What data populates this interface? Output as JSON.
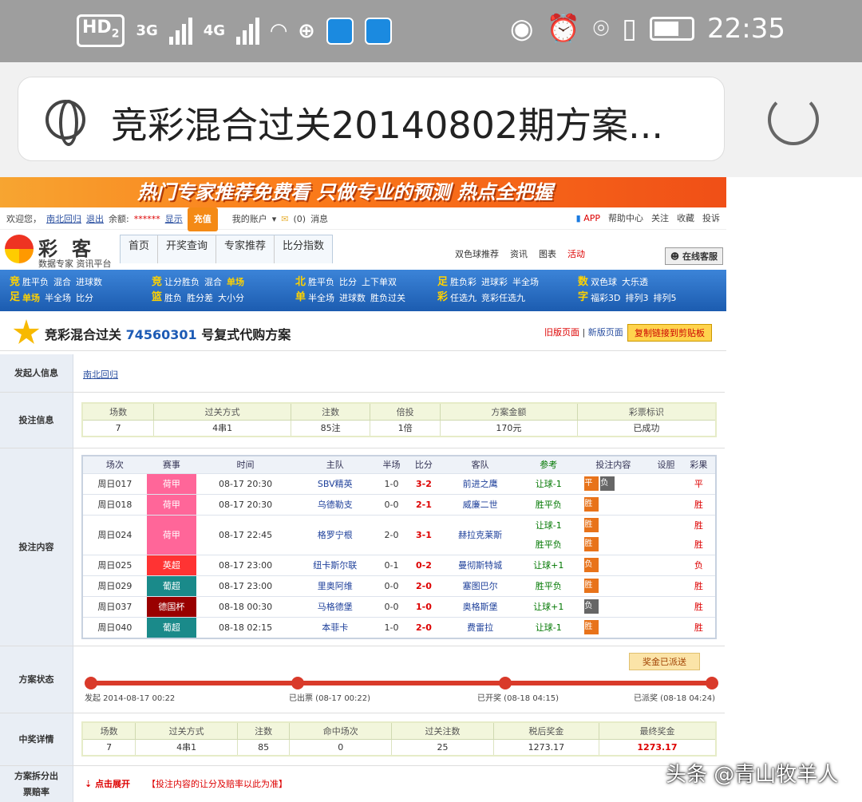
{
  "status_bar": {
    "hd": "HD",
    "sim2": "2",
    "net3g": "3G",
    "net4g": "4G",
    "time": "22:35"
  },
  "browser": {
    "url_title": "竞彩混合过关20140802期方案..."
  },
  "banner": {
    "text": "热门专家推荐免费看 只做专业的预测 热点全把握"
  },
  "topbar": {
    "welcome": "欢迎您，",
    "username": "南北回归",
    "logout": "退出",
    "balance_label": "余额:",
    "balance_value": "******",
    "show": "显示",
    "recharge": "充值",
    "my_account": "我的账户",
    "msgs": "(0)",
    "msg_label": "消息",
    "right": [
      "APP",
      "帮助中心",
      "关注",
      "收藏",
      "投诉"
    ]
  },
  "logo": {
    "title": "彩客",
    "sub": "数据专家 资讯平台"
  },
  "nav": {
    "items": [
      "首页",
      "开奖查询",
      "专家推荐",
      "比分指数"
    ],
    "right": [
      "双色球推荐",
      "资讯",
      "图表",
      "活动"
    ],
    "kefu": "在线客服"
  },
  "blue_nav": [
    {
      "tag": "竞足",
      "row1": [
        "胜平负",
        "混合",
        "进球数"
      ],
      "row2": [
        "单场",
        "半全场",
        "比分"
      ]
    },
    {
      "tag": "竞篮",
      "row1": [
        "让分胜负",
        "混合",
        "单场"
      ],
      "row2": [
        "胜负",
        "胜分差",
        "大小分"
      ]
    },
    {
      "tag": "北单",
      "row1": [
        "胜平负",
        "比分",
        "上下单双"
      ],
      "row2": [
        "半全场",
        "进球数",
        "胜负过关"
      ]
    },
    {
      "tag": "足彩",
      "row1": [
        "胜负彩",
        "进球彩",
        "半全场"
      ],
      "row2": [
        "任选九",
        "竞彩任选九"
      ]
    },
    {
      "tag": "数字",
      "row1": [
        "双色球",
        "大乐透"
      ],
      "row2": [
        "福彩3D",
        "排列3",
        "排列5"
      ]
    }
  ],
  "plan": {
    "title_pre": "竞彩混合过关",
    "plan_no": "74560301",
    "title_post": "号复式代购方案",
    "old_page": "旧版页面",
    "sep": "|",
    "new_page": "新版页面",
    "copy_btn": "复制链接到剪贴板"
  },
  "sections": {
    "sponsor": "发起人信息",
    "bet_info": "投注信息",
    "bet_content": "投注内容",
    "status": "方案状态",
    "prize": "中奖详情",
    "split": "方案拆分出票赔率"
  },
  "sponsor_name": "南北回归",
  "bet_info": {
    "headers": [
      "场数",
      "过关方式",
      "注数",
      "倍投",
      "方案金额",
      "彩票标识"
    ],
    "values": [
      "7",
      "4串1",
      "85注",
      "1倍",
      "170元",
      "已成功"
    ]
  },
  "bet_table": {
    "headers": [
      "场次",
      "赛事",
      "时间",
      "主队",
      "半场",
      "比分",
      "客队",
      "参考",
      "投注内容",
      "设胆",
      "彩果"
    ],
    "rows": [
      {
        "no": "周日017",
        "league": "荷甲",
        "lcolor": "#ff6699",
        "time": "08-17 20:30",
        "home": "SBV精英",
        "half": "1-0",
        "score": "3-2",
        "away": "前进之鹰",
        "ref": "让球-1",
        "picks": [
          "平",
          "负"
        ],
        "pickgray": [
          false,
          true
        ],
        "result": "平"
      },
      {
        "no": "周日018",
        "league": "荷甲",
        "lcolor": "#ff6699",
        "time": "08-17 20:30",
        "home": "乌德勒支",
        "half": "0-0",
        "score": "2-1",
        "away": "威廉二世",
        "ref": "胜平负",
        "picks": [
          "胜"
        ],
        "pickgray": [
          false
        ],
        "result": "胜"
      },
      {
        "no": "周日024",
        "league": "荷甲",
        "lcolor": "#ff6699",
        "time": "08-17 22:45",
        "home": "格罗宁根",
        "half": "2-0",
        "score": "3-1",
        "away": "赫拉克莱斯",
        "ref": "让球-1",
        "ref2": "胜平负",
        "picks": [
          "胜"
        ],
        "picks2": [
          "胜"
        ],
        "pickgray": [
          false
        ],
        "result": "胜",
        "result2": "胜"
      },
      {
        "no": "周日025",
        "league": "英超",
        "lcolor": "#ff3333",
        "time": "08-17 23:00",
        "home": "纽卡斯尔联",
        "half": "0-1",
        "score": "0-2",
        "away": "曼彻斯特城",
        "ref": "让球+1",
        "picks": [
          "负"
        ],
        "pickgray": [
          false
        ],
        "result": "负"
      },
      {
        "no": "周日029",
        "league": "葡超",
        "lcolor": "#1a8a8a",
        "time": "08-17 23:00",
        "home": "里奥阿维",
        "half": "0-0",
        "score": "2-0",
        "away": "塞图巴尔",
        "ref": "胜平负",
        "picks": [
          "胜"
        ],
        "pickgray": [
          false
        ],
        "result": "胜"
      },
      {
        "no": "周日037",
        "league": "德国杯",
        "lcolor": "#990000",
        "time": "08-18 00:30",
        "home": "马格德堡",
        "half": "0-0",
        "score": "1-0",
        "away": "奥格斯堡",
        "ref": "让球+1",
        "picks": [
          "负"
        ],
        "pickgray": [
          true
        ],
        "result": "胜"
      },
      {
        "no": "周日040",
        "league": "葡超",
        "lcolor": "#1a8a8a",
        "time": "08-18 02:15",
        "home": "本菲卡",
        "half": "1-0",
        "score": "2-0",
        "away": "费雷拉",
        "ref": "让球-1",
        "picks": [
          "胜"
        ],
        "pickgray": [
          false
        ],
        "result": "胜"
      }
    ]
  },
  "status": {
    "sent": "奖金已派送",
    "steps": [
      "发起 2014-08-17 00:22",
      "已出票 (08-17 00:22)",
      "已开奖 (08-18 04:15)",
      "已派奖 (08-18 04:24)"
    ]
  },
  "prize": {
    "headers": [
      "场数",
      "过关方式",
      "注数",
      "命中场次",
      "过关注数",
      "税后奖金",
      "最终奖金"
    ],
    "values": [
      "7",
      "4串1",
      "85",
      "0",
      "25",
      "1273.17",
      "1273.17"
    ]
  },
  "split": {
    "expand": "点击展开",
    "note": "【投注内容的让分及赔率以此为准】"
  },
  "watermark": "头条 @青山牧羊人",
  "colors": {
    "accent": "#1c5cb0",
    "orange": "#f48a16",
    "red": "#d93a2a"
  }
}
